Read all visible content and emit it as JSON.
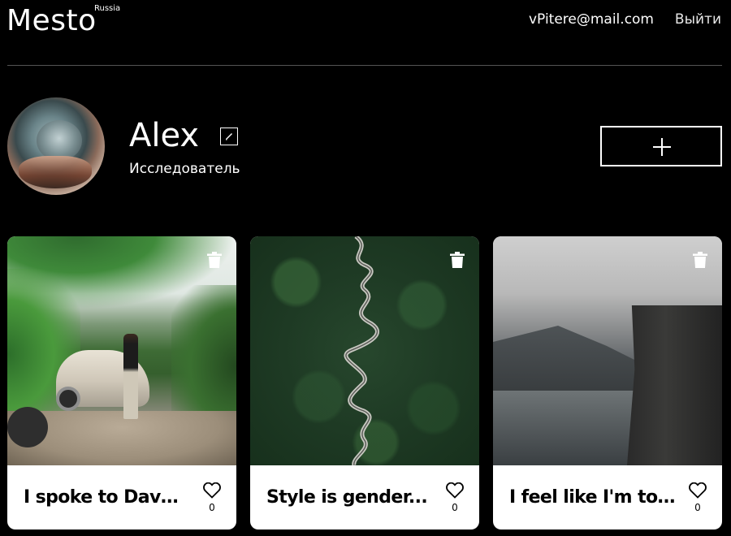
{
  "header": {
    "logo": "Mesto",
    "logo_sub": "Russia",
    "email": "vPitere@mail.com",
    "logout_label": "Выйти"
  },
  "profile": {
    "name": "Alex",
    "about": "Исследователь",
    "edit_icon": "pencil-icon",
    "add_icon": "plus-icon"
  },
  "cards": [
    {
      "title": "I spoke to Dave...",
      "likes": "0",
      "image": "garden-with-car-and-person"
    },
    {
      "title": "Style is gender...",
      "likes": "0",
      "image": "forest-with-winding-road"
    },
    {
      "title": "I feel like I'm to...",
      "likes": "0",
      "image": "cliff-over-fjord"
    }
  ],
  "colors": {
    "background": "#000000",
    "text": "#ffffff",
    "card_background": "#ffffff",
    "card_text": "#000000",
    "divider": "#545454"
  }
}
